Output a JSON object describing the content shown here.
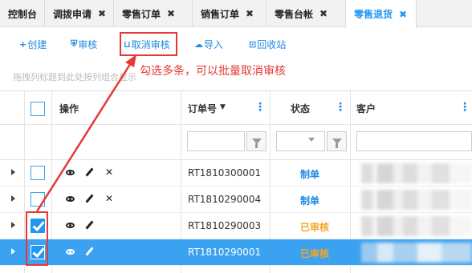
{
  "tabs": [
    {
      "label": "控制台",
      "closable": false
    },
    {
      "label": "调拨申请",
      "closable": true
    },
    {
      "label": "零售订单",
      "closable": true
    },
    {
      "label": "销售订单",
      "closable": true
    },
    {
      "label": "零售台帐",
      "closable": true
    },
    {
      "label": "零售退货",
      "closable": true,
      "active": true
    }
  ],
  "toolbar": {
    "create": "创建",
    "audit": "审核",
    "cancel_audit": "取消审核",
    "import": "导入",
    "recycle": "回收站"
  },
  "annotation": "勾选多条，可以批量取消审核",
  "group_hint": "拖拽列标题到此处按列组合显示",
  "columns": {
    "ops": "操作",
    "order_no": "订单号",
    "status": "状态",
    "customer": "客户"
  },
  "rows": [
    {
      "order": "RT1810300001",
      "status": "制单",
      "checked": false,
      "deletable": true
    },
    {
      "order": "RT1810290004",
      "status": "制单",
      "checked": false,
      "deletable": true
    },
    {
      "order": "RT1810290003",
      "status": "已审核",
      "checked": true,
      "deletable": false
    },
    {
      "order": "RT1810290001",
      "status": "已审核",
      "checked": true,
      "deletable": false,
      "selected": true
    }
  ],
  "colors": {
    "accent": "#2196f3",
    "status_draft": "#1e88e5",
    "status_audited": "#f5a623",
    "annotation": "#e53935",
    "selected_row": "#3ba2f2"
  },
  "icons": {
    "expand": "triangle-right-icon",
    "view": "eye-icon",
    "edit": "pencil-icon",
    "delete": "x-icon",
    "filter": "funnel-icon",
    "kebab": "kebab-icon"
  }
}
